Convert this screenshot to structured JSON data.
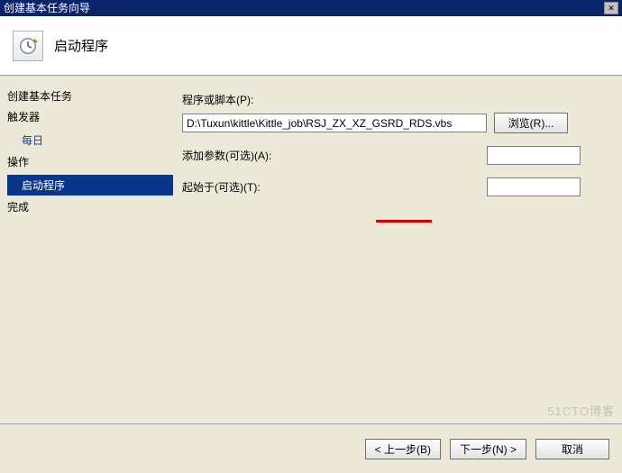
{
  "window": {
    "title": "创建基本任务向导"
  },
  "header": {
    "title": "启动程序"
  },
  "sidebar": {
    "create_heading": "创建基本任务",
    "trigger_heading": "触发器",
    "trigger_item": "每日",
    "action_heading": "操作",
    "action_item": "启动程序",
    "finish_heading": "完成"
  },
  "form": {
    "program_label": "程序或脚本(P):",
    "program_value": "D:\\Tuxun\\kittle\\Kittle_job\\RSJ_ZX_XZ_GSRD_RDS.vbs",
    "browse_label": "浏览(R)...",
    "args_label": "添加参数(可选)(A):",
    "args_value": "",
    "startin_label": "起始于(可选)(T):",
    "startin_value": ""
  },
  "footer": {
    "back": "< 上一步(B)",
    "next": "下一步(N) >",
    "cancel": "取消"
  },
  "watermark": "51CTO博客"
}
